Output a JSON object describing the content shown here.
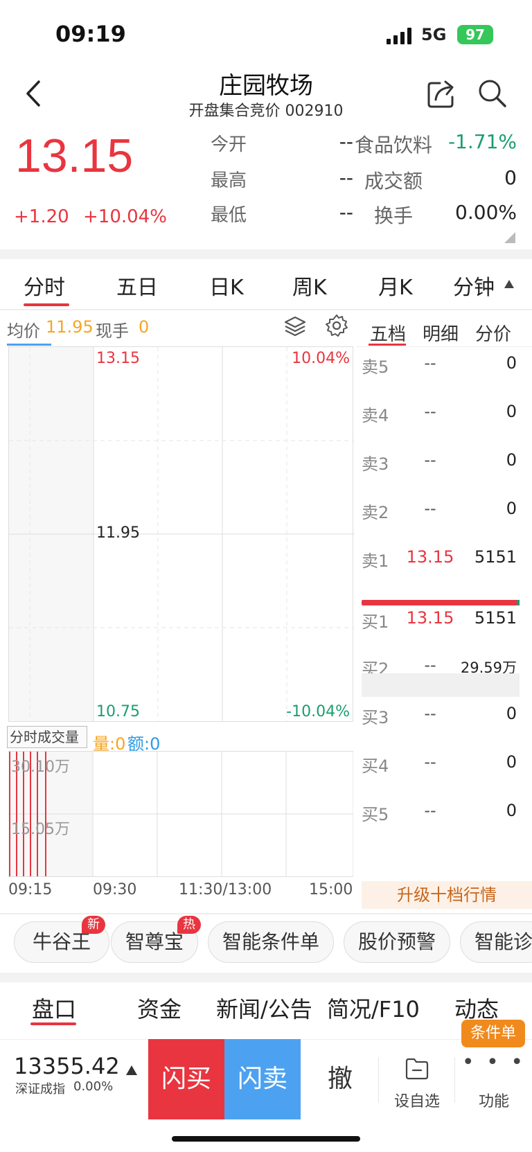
{
  "status": {
    "time": "09:19",
    "network": "5G",
    "battery": "97"
  },
  "header": {
    "title": "庄园牧场",
    "subtitle": "开盘集合竞价 002910"
  },
  "quote": {
    "price": "13.15",
    "change": "+1.20",
    "change_pct": "+10.04%",
    "open_label": "今开",
    "open_value": "--",
    "high_label": "最高",
    "high_value": "--",
    "low_label": "最低",
    "low_value": "--",
    "sector_label": "食品饮料",
    "sector_value": "-1.71%",
    "turnover_label": "成交额",
    "turnover_value": "0",
    "turnrate_label": "换手",
    "turnrate_value": "0.00%"
  },
  "chart_tabs": [
    "分时",
    "五日",
    "日K",
    "周K",
    "月K",
    "分钟"
  ],
  "intraday": {
    "avg_label": "均价",
    "avg_value": "11.95",
    "cur_hand_label": "现手",
    "cur_hand_value": "0",
    "top_price": "13.15",
    "mid_price": "11.95",
    "bottom_price": "10.75",
    "top_pct": "10.04%",
    "bottom_pct": "-10.04%",
    "vol_selector": "分时成交量",
    "vol_label": "量:",
    "vol_value": "0",
    "amt_label": "额:",
    "amt_value": "0",
    "vol_max": "30.10万",
    "vol_mid": "15.05万",
    "time_ticks": [
      "09:15",
      "09:30",
      "11:30/13:00",
      "15:00"
    ]
  },
  "orderbook": {
    "tabs": [
      "五档",
      "明细",
      "分价"
    ],
    "rows": [
      {
        "label": "卖5",
        "price": "--",
        "vol": "0"
      },
      {
        "label": "卖4",
        "price": "--",
        "vol": "0"
      },
      {
        "label": "卖3",
        "price": "--",
        "vol": "0"
      },
      {
        "label": "卖2",
        "price": "--",
        "vol": "0"
      },
      {
        "label": "卖1",
        "price": "13.15",
        "vol": "5151"
      },
      {
        "label": "买1",
        "price": "13.15",
        "vol": "5151"
      },
      {
        "label": "买2",
        "price": "--",
        "vol": "29.59万"
      },
      {
        "label": "买3",
        "price": "--",
        "vol": "0"
      },
      {
        "label": "买4",
        "price": "--",
        "vol": "0"
      },
      {
        "label": "买5",
        "price": "--",
        "vol": "0"
      }
    ],
    "upgrade": "升级十档行情"
  },
  "tools": [
    {
      "label": "牛谷王",
      "badge": "新"
    },
    {
      "label": "智尊宝",
      "badge": "热"
    },
    {
      "label": "智能条件单",
      "badge": ""
    },
    {
      "label": "股价预警",
      "badge": ""
    },
    {
      "label": "智能诊",
      "badge": ""
    }
  ],
  "bottom_tabs": [
    "盘口",
    "资金",
    "新闻/公告",
    "简况/F10",
    "动态"
  ],
  "bottom_bar": {
    "index_value": "13355.42",
    "index_name": "深证成指",
    "index_pct": "0.00%",
    "flash_buy": "闪买",
    "flash_sell": "闪卖",
    "cancel": "撤",
    "watchlist": "设自选",
    "functions": "功能",
    "cond_badge": "条件单"
  },
  "colors": {
    "red": "#e8353f",
    "green": "#1a9e6e",
    "blue": "#4ca2f0",
    "orange": "#f5a623"
  }
}
